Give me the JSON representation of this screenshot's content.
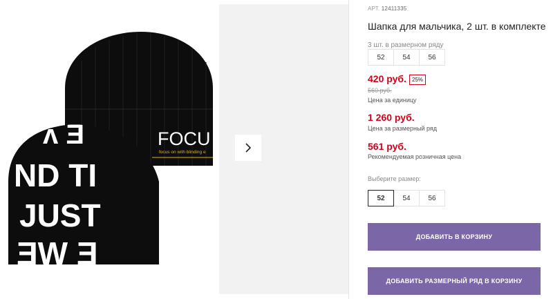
{
  "product": {
    "sku_label": "АРТ.",
    "sku_number": "12411335",
    "title": "Шапка для мальчика, 2 шт. в комплекте",
    "set_note": "3 шт. в размерном ряду",
    "set_sizes": [
      "52",
      "54",
      "56"
    ]
  },
  "image": {
    "hat1_text": "FOCU",
    "hat1_tagline": "focus on with blinding e",
    "hat2_lines": [
      "ʌ Ǝ",
      "ND TI",
      "JUST",
      "ƎW Ǝ"
    ]
  },
  "prices": {
    "unit_price": "420 руб.",
    "discount_badge": "25%",
    "old_price": "560 руб.",
    "unit_note": "Цена за единицу",
    "set_price": "1 260 руб.",
    "set_note": "Цена за размерный ряд",
    "rrp_price": "561 руб.",
    "rrp_note": "Рекомендуемая розничная цена"
  },
  "size_select": {
    "label": "Выберите размер:",
    "options": [
      "52",
      "54",
      "56"
    ],
    "selected": "52"
  },
  "buttons": {
    "add_to_cart": "ДОБАВИТЬ В КОРЗИНУ",
    "add_set_to_cart": "ДОБАВИТЬ РАЗМЕРНЫЙ РЯД В КОРЗИНУ"
  },
  "colors": {
    "price_red": "#d0021b",
    "button_purple": "#7b66a8"
  },
  "icons": {
    "gallery_next": "chevron-right-icon"
  }
}
